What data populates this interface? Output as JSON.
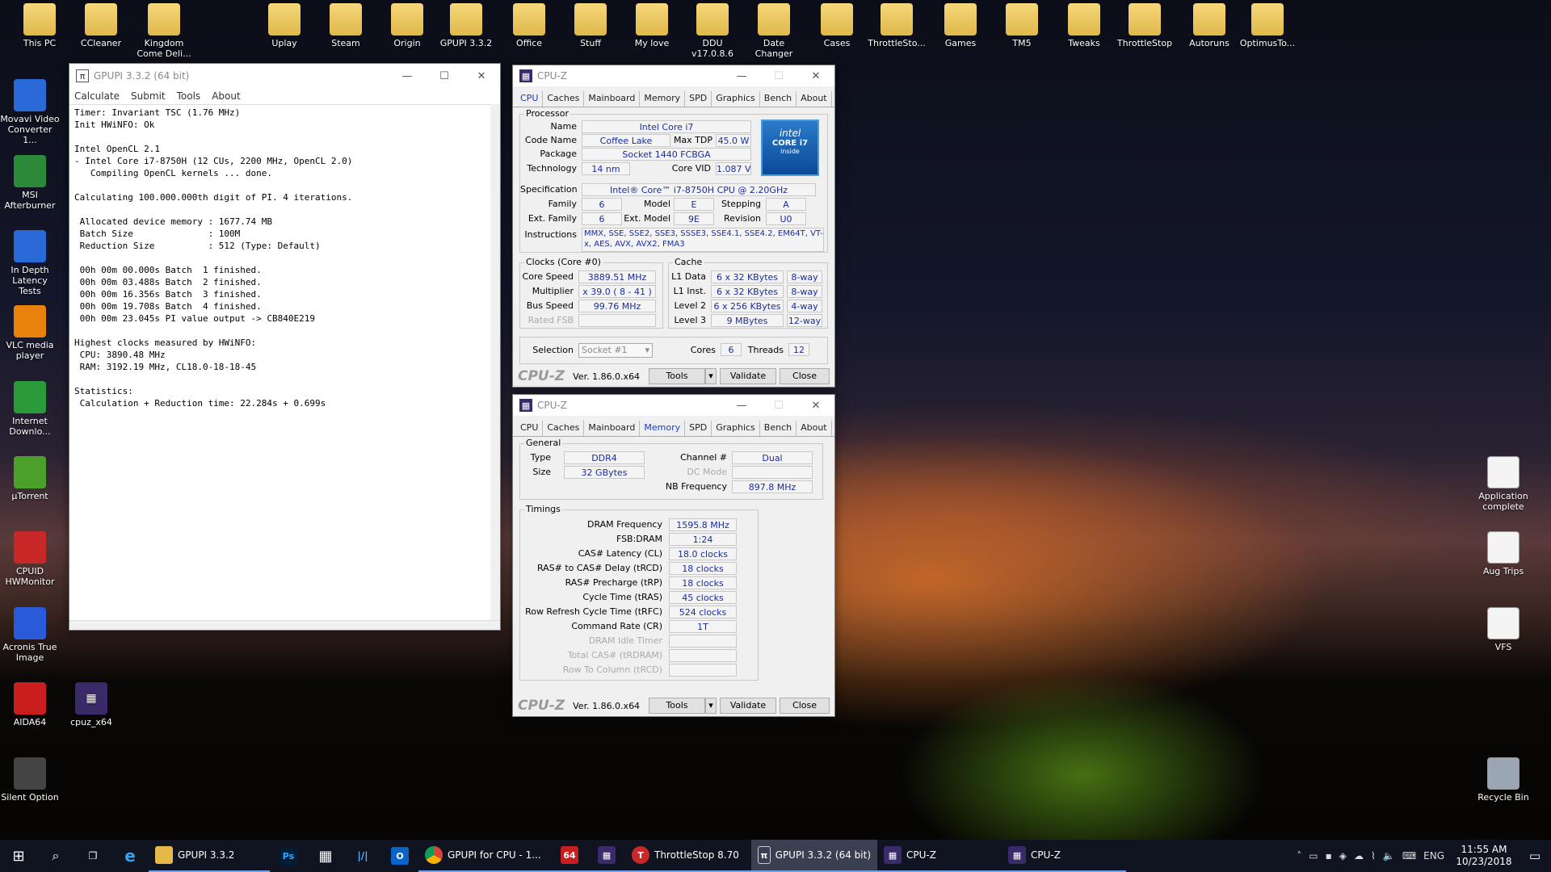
{
  "desktop": {
    "top_icons": [
      "This PC",
      "CCleaner",
      "Kingdom Come Deli...",
      "Uplay",
      "Steam",
      "Origin",
      "GPUPI 3.3.2",
      "Office",
      "Stuff",
      "My love",
      "DDU v17.0.8.6",
      "Date Changer",
      "Cases",
      "ThrottleSto...",
      "Games",
      "TM5",
      "Tweaks",
      "ThrottleStop",
      "Autoruns",
      "OptimusTo..."
    ],
    "left_icons": [
      "Movavi Video Converter 1...",
      "MSI Afterburner",
      "In Depth Latency Tests",
      "VLC media player",
      "Internet Downlo...",
      "µTorrent",
      "CPUID HWMonitor",
      "Acronis True Image",
      "AIDA64",
      "Silent Option"
    ],
    "extra_icon": "cpuz_x64",
    "right_icons": [
      "Application complete",
      "Aug Trips",
      "VFS",
      "Recycle Bin"
    ]
  },
  "gpupi": {
    "title": "GPUPI 3.3.2 (64 bit)",
    "menu": [
      "Calculate",
      "Submit",
      "Tools",
      "About"
    ],
    "lines": [
      "Timer: Invariant TSC (1.76 MHz)",
      "Init HWiNFO: Ok",
      "",
      "Intel OpenCL 2.1",
      "- Intel Core i7-8750H (12 CUs, 2200 MHz, OpenCL 2.0)",
      "   Compiling OpenCL kernels ... done.",
      "",
      "Calculating 100.000.000th digit of PI. 4 iterations.",
      "",
      " Allocated device memory : 1677.74 MB",
      " Batch Size              : 100M",
      " Reduction Size          : 512 (Type: Default)",
      "",
      " 00h 00m 00.000s Batch  1 finished.",
      " 00h 00m 03.488s Batch  2 finished.",
      " 00h 00m 16.356s Batch  3 finished.",
      " 00h 00m 19.708s Batch  4 finished.",
      " 00h 00m 23.045s PI value output -> CB840E219",
      "",
      "Highest clocks measured by HWiNFO:",
      " CPU: 3890.48 MHz",
      " RAM: 3192.19 MHz, CL18.0-18-18-45",
      "",
      "Statistics:",
      " Calculation + Reduction time: 22.284s + 0.699s"
    ]
  },
  "cpuz_cpu": {
    "title": "CPU-Z",
    "tabs": [
      "CPU",
      "Caches",
      "Mainboard",
      "Memory",
      "SPD",
      "Graphics",
      "Bench",
      "About"
    ],
    "processor": "Processor",
    "name_l": "Name",
    "name": "Intel Core i7",
    "code_l": "Code Name",
    "code": "Coffee Lake",
    "tdp_l": "Max TDP",
    "tdp": "45.0 W",
    "pkg_l": "Package",
    "pkg": "Socket 1440 FCBGA",
    "tech_l": "Technology",
    "tech": "14 nm",
    "vid_l": "Core VID",
    "vid": "1.087 V",
    "spec_l": "Specification",
    "spec": "Intel® Core™ i7-8750H CPU @ 2.20GHz",
    "fam_l": "Family",
    "fam": "6",
    "model_l": "Model",
    "model": "E",
    "step_l": "Stepping",
    "step": "A",
    "efam_l": "Ext. Family",
    "efam": "6",
    "emodel_l": "Ext. Model",
    "emodel": "9E",
    "rev_l": "Revision",
    "rev": "U0",
    "instr_l": "Instructions",
    "instr": "MMX, SSE, SSE2, SSE3, SSSE3, SSE4.1, SSE4.2, EM64T, VT-x, AES, AVX, AVX2, FMA3",
    "clocks": "Clocks (Core #0)",
    "cs_l": "Core Speed",
    "cs": "3889.51 MHz",
    "mul_l": "Multiplier",
    "mul": "x 39.0 ( 8 - 41 )",
    "bus_l": "Bus Speed",
    "bus": "99.76 MHz",
    "fsb_l": "Rated FSB",
    "cache": "Cache",
    "l1d_l": "L1 Data",
    "l1d": "6 x 32 KBytes",
    "l1d_w": "8-way",
    "l1i_l": "L1 Inst.",
    "l1i": "6 x 32 KBytes",
    "l1i_w": "8-way",
    "l2_l": "Level 2",
    "l2": "6 x 256 KBytes",
    "l2_w": "4-way",
    "l3_l": "Level 3",
    "l3": "9 MBytes",
    "l3_w": "12-way",
    "sel_l": "Selection",
    "sel": "Socket #1",
    "cores_l": "Cores",
    "cores": "6",
    "thr_l": "Threads",
    "thr": "12",
    "logo": "CPU-Z",
    "ver": "Ver. 1.86.0.x64",
    "tools": "Tools",
    "validate": "Validate",
    "close": "Close",
    "badge1": "intel",
    "badge2": "CORE i7",
    "badge3": "inside"
  },
  "cpuz_mem": {
    "title": "CPU-Z",
    "tabs": [
      "CPU",
      "Caches",
      "Mainboard",
      "Memory",
      "SPD",
      "Graphics",
      "Bench",
      "About"
    ],
    "general": "General",
    "type_l": "Type",
    "type": "DDR4",
    "chan_l": "Channel #",
    "chan": "Dual",
    "size_l": "Size",
    "size": "32 GBytes",
    "dc_l": "DC Mode",
    "nb_l": "NB Frequency",
    "nb": "897.8 MHz",
    "timings": "Timings",
    "rows": [
      {
        "l": "DRAM Frequency",
        "v": "1595.8 MHz"
      },
      {
        "l": "FSB:DRAM",
        "v": "1:24"
      },
      {
        "l": "CAS# Latency (CL)",
        "v": "18.0 clocks"
      },
      {
        "l": "RAS# to CAS# Delay (tRCD)",
        "v": "18 clocks"
      },
      {
        "l": "RAS# Precharge (tRP)",
        "v": "18 clocks"
      },
      {
        "l": "Cycle Time (tRAS)",
        "v": "45 clocks"
      },
      {
        "l": "Row Refresh Cycle Time (tRFC)",
        "v": "524 clocks"
      },
      {
        "l": "Command Rate (CR)",
        "v": "1T"
      }
    ],
    "dim_rows": [
      "DRAM Idle Timer",
      "Total CAS# (tRDRAM)",
      "Row To Column (tRCD)"
    ],
    "logo": "CPU-Z",
    "ver": "Ver. 1.86.0.x64",
    "tools": "Tools",
    "validate": "Validate",
    "close": "Close"
  },
  "taskbar": {
    "items": [
      "GPUPI 3.3.2",
      "GPUPI for CPU - 1...",
      "ThrottleStop 8.70",
      "GPUPI 3.3.2 (64 bit)",
      "CPU-Z",
      "CPU-Z"
    ],
    "lang": "ENG",
    "time": "11:55 AM",
    "date": "10/23/2018"
  }
}
